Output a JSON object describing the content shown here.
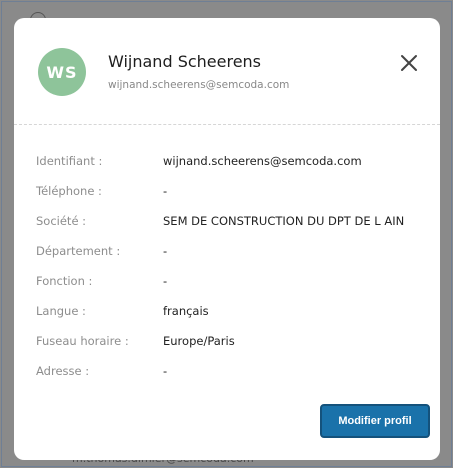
{
  "background": {
    "peek_text": "m.thomas.dimier@semcoda.com"
  },
  "profile": {
    "initials": "WS",
    "name": "Wijnand Scheerens",
    "email": "wijnand.scheerens@semcoda.com",
    "avatar_color": "#8ec49a"
  },
  "fields": [
    {
      "label": "Identifiant :",
      "value": "wijnand.scheerens@semcoda.com"
    },
    {
      "label": "Téléphone :",
      "value": "-"
    },
    {
      "label": "Société :",
      "value": "SEM DE CONSTRUCTION DU DPT DE L AIN"
    },
    {
      "label": "Département :",
      "value": "-"
    },
    {
      "label": "Fonction :",
      "value": "-"
    },
    {
      "label": "Langue :",
      "value": "français"
    },
    {
      "label": "Fuseau horaire :",
      "value": "Europe/Paris"
    },
    {
      "label": "Adresse :",
      "value": "-"
    }
  ],
  "actions": {
    "edit_label": "Modifier profil",
    "close_icon": "close-icon"
  },
  "colors": {
    "accent": "#1a72aa",
    "overlay": "#8a8a8a"
  }
}
